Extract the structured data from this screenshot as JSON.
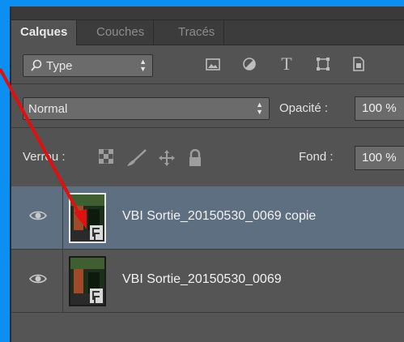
{
  "panel": {
    "tabs": [
      {
        "label": "Calques",
        "active": true
      },
      {
        "label": "Couches",
        "active": false
      },
      {
        "label": "Tracés",
        "active": false
      }
    ],
    "filter": {
      "label": "Type",
      "icons": [
        "image-filter-icon",
        "adjustment-filter-icon",
        "type-filter-icon",
        "shape-filter-icon",
        "smart-object-filter-icon"
      ]
    },
    "blend_mode": {
      "value": "Normal"
    },
    "opacity": {
      "label": "Opacité :",
      "value": "100 %"
    },
    "lock": {
      "label": "Verrou :",
      "icons": [
        "lock-transparent-icon",
        "lock-pixels-icon",
        "lock-position-icon",
        "lock-all-icon"
      ]
    },
    "fill": {
      "label": "Fond :",
      "value": "100 %"
    },
    "layers": [
      {
        "name": "VBI Sortie_20150530_0069 copie",
        "selected": true,
        "visible": true
      },
      {
        "name": "VBI Sortie_20150530_0069",
        "selected": false,
        "visible": true
      }
    ]
  },
  "colors": {
    "panel_bg": "#535353",
    "selected_layer": "#5e6f82",
    "annotation_arrow": "#e01010",
    "frame": "#0b8ff0"
  }
}
